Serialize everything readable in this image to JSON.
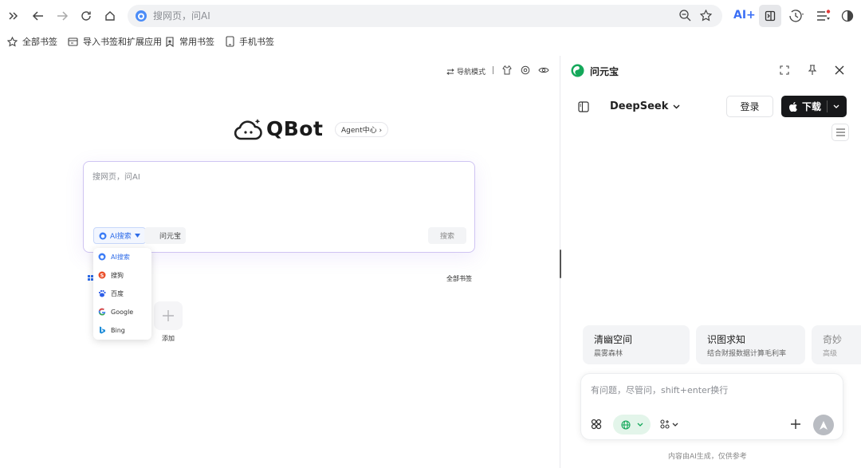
{
  "browser": {
    "address_placeholder": "搜网页，问AI",
    "ai_button_label": "AI+"
  },
  "bookmarks": [
    {
      "label": "全部书签",
      "icon": "star-icon"
    },
    {
      "label": "导入书签和扩展应用",
      "icon": "import-icon"
    },
    {
      "label": "常用书签",
      "icon": "bookmark-icon"
    },
    {
      "label": "手机书签",
      "icon": "phone-icon"
    }
  ],
  "newtab": {
    "nav_mode_label": "导航模式",
    "logo_text": "QBot",
    "agent_center_label": "Agent中心 ›",
    "search_placeholder": "搜网页，问AI",
    "engine_selected": "AI搜索",
    "yuanbao_chip": "问元宝",
    "search_button": "搜索",
    "all_bookmarks_link": "全部书签",
    "add_label": "添加",
    "engines": [
      {
        "label": "AI搜索",
        "icon": "ai-search-icon",
        "color": "#3b7cf6"
      },
      {
        "label": "搜狗",
        "icon": "sogou-icon",
        "color": "#ea4f2a"
      },
      {
        "label": "百度",
        "icon": "baidu-icon",
        "color": "#2e5ee8"
      },
      {
        "label": "Google",
        "icon": "google-icon",
        "color": "#4285f4"
      },
      {
        "label": "Bing",
        "icon": "bing-icon",
        "color": "#1b8bd8"
      }
    ]
  },
  "assistant": {
    "title": "问元宝",
    "model": "DeepSeek",
    "login_button": "登录",
    "download_button": "下载",
    "suggestions": [
      {
        "title": "清幽空间",
        "subtitle": "晨雾森林"
      },
      {
        "title": "识图求知",
        "subtitle": "结合财报数据计算毛利率"
      },
      {
        "title": "奇妙",
        "subtitle": "高级"
      }
    ],
    "input_placeholder": "有问题，尽管问，shift+enter换行",
    "footer_note": "内容由AI生成，仅供参考",
    "accent_color": "#14a85a"
  }
}
